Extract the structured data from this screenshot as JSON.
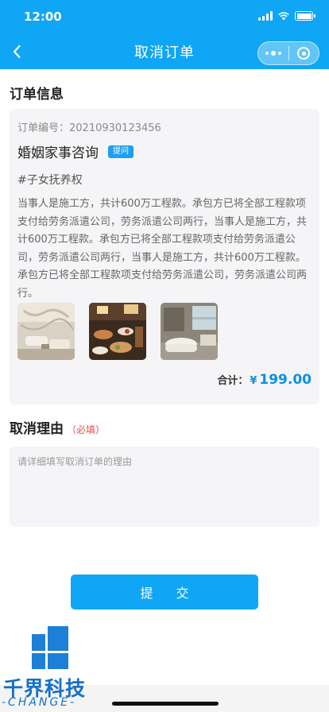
{
  "status_bar": {
    "time": "12:00"
  },
  "nav": {
    "title": "取消订单",
    "back_icon": "chevron-left-icon",
    "more_icon": "more-dots-icon",
    "close_icon": "target-close-icon"
  },
  "order_info": {
    "section_title": "订单信息",
    "order_number": "订单编号：20210930123456",
    "service_name": "婚姻家事咨询",
    "badge": "提问",
    "tag": "#子女抚养权",
    "description": "当事人是施工方，共计600万工程款。承包方已将全部工程款项支付给劳务派遣公司，劳务派遣公司两行，当事人是施工方，共计600万工程款。承包方已将全部工程款项支付给劳务派遣公司，劳务派遣公司两行，当事人是施工方，共计600万工程款。承包方已将全部工程款项支付给劳务派遣公司，劳务派遣公司两行。",
    "photos": [
      "lounge-photo",
      "buffet-photo",
      "bathroom-photo"
    ],
    "total_label": "合计：",
    "currency": "¥",
    "total_amount": "199.00",
    "accent_color": "#0c90e0"
  },
  "cancel_reason": {
    "section_title": "取消理由",
    "required_label": "（必填）",
    "placeholder": "请详细填写取消订单的理由",
    "value": ""
  },
  "submit_label": "提 交",
  "watermark": {
    "text": "千界科技",
    "subtext": "-CHANGE-"
  },
  "colors": {
    "primary": "#0fa6f5",
    "card_bg": "#f5f5f7",
    "required": "#f04848"
  }
}
